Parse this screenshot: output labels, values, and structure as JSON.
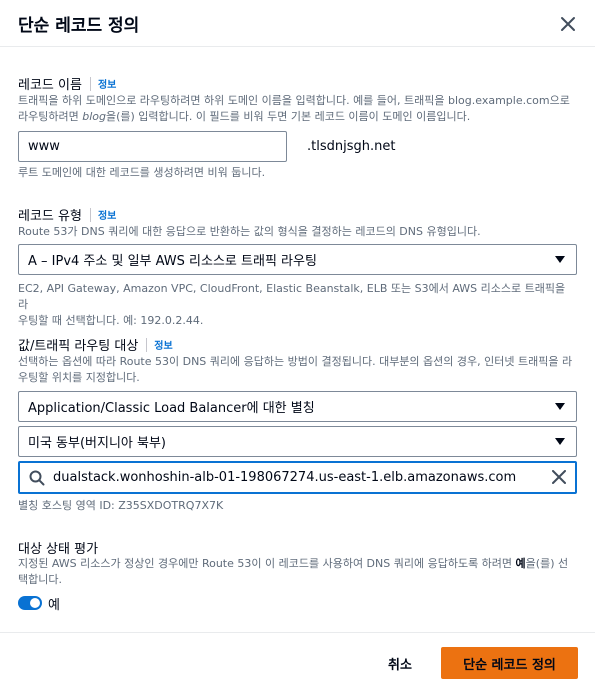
{
  "modal": {
    "title": "단순 레코드 정의"
  },
  "record_name": {
    "label": "레코드 이름",
    "info": "정보",
    "desc_line1": "트래픽을 하위 도메인으로 라우팅하려면 하위 도메인 이름을 입력합니다. 예를 들어, 트래픽을 blog.example.com으로",
    "desc_line2_pre": "라우팅하려면 ",
    "desc_line2_em": "blog",
    "desc_line2_post": "을(를) 입력합니다. 이 필드를 비워 두면 기본 레코드 이름이 도메인 이름입니다.",
    "value": "www",
    "suffix": ".tlsdnjsgh.net",
    "hint": "루트 도메인에 대한 레코드를 생성하려면 비워 둡니다."
  },
  "record_type": {
    "label": "레코드 유형",
    "info": "정보",
    "desc": "Route 53가 DNS 쿼리에 대한 응답으로 반환하는 값의 형식을 결정하는 레코드의 DNS 유형입니다.",
    "selected": "A – IPv4 주소 및 일부 AWS 리소스로 트래픽 라우팅",
    "hint_line1": "EC2, API Gateway, Amazon VPC, CloudFront, Elastic Beanstalk, ELB 또는 S3에서 AWS 리소스로 트래픽을 라",
    "hint_line2": "우팅할 때 선택합니다. 예: 192.0.2.44."
  },
  "route_target": {
    "label": "값/트래픽 라우팅 대상",
    "info": "정보",
    "desc_line1": "선택하는 옵션에 따라 Route 53이 DNS 쿼리에 응답하는 방법이 결정됩니다. 대부분의 옵션의 경우, 인터넷 트래픽을 라",
    "desc_line2": "우팅할 위치를 지정합니다.",
    "endpoint_type": "Application/Classic Load Balancer에 대한 별칭",
    "region": "미국 동부(버지니아 북부)",
    "search_value": "dualstack.wonhoshin-alb-01-198067274.us-east-1.elb.amazonaws.com",
    "hosted_zone": "별칭 호스팅 영역 ID: Z35SXDOTRQ7X7K"
  },
  "health": {
    "label": "대상 상태 평가",
    "desc_line1_pre": "지정된 AWS 리소스가 정상인 경우에만 Route 53이 이 레코드를 사용하여 DNS 쿼리에 응답하도록 하려면 ",
    "desc_line1_strong": "예",
    "desc_line1_post": "을(를) 선",
    "desc_line2": "택합니다.",
    "toggle_label": "예",
    "toggle_on": true
  },
  "footer": {
    "cancel": "취소",
    "submit": "단순 레코드 정의"
  },
  "colors": {
    "primary": "#ec7211",
    "link": "#0972d3",
    "focus": "#0972d3",
    "text": "#000716",
    "muted": "#5f6b7a"
  },
  "icons": {
    "close": "close-icon",
    "caret": "caret-down-icon",
    "search": "search-icon",
    "clear": "clear-icon"
  }
}
